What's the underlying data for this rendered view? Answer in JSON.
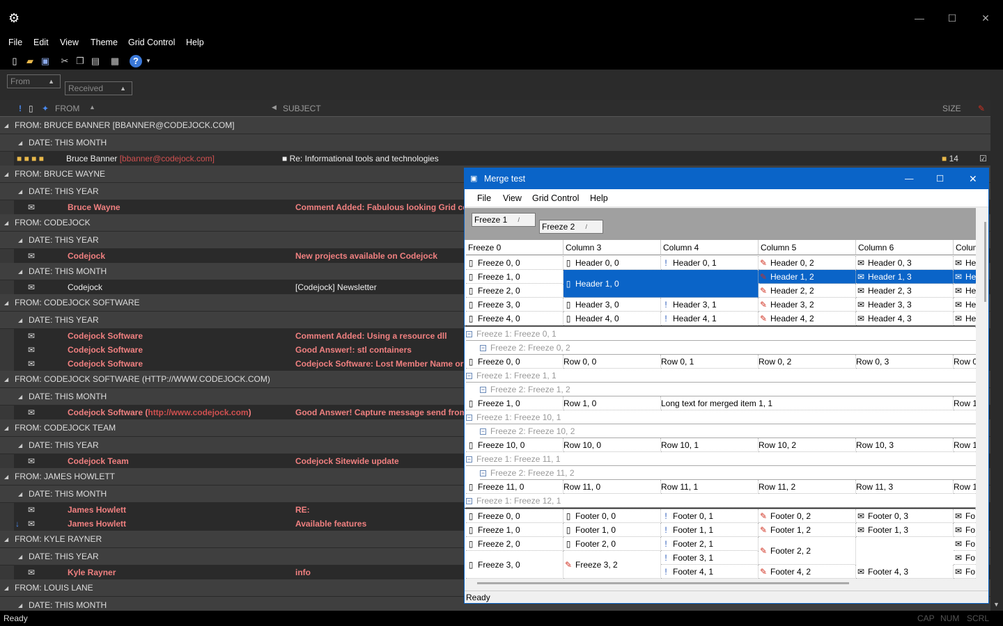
{
  "window": {
    "minimize": "—",
    "maximize": "☐",
    "close": "✕",
    "app_icon": "⚙"
  },
  "menu": [
    "File",
    "Edit",
    "View",
    "Theme",
    "Grid Control",
    "Help"
  ],
  "group_chips": [
    "From",
    "Received"
  ],
  "columns": {
    "from": "FROM",
    "subject": "SUBJECT",
    "size": "SIZE"
  },
  "rows": [
    {
      "kind": "grp",
      "level": 0,
      "label": "FROM: BRUCE BANNER [BBANNER@CODEJOCK.COM]"
    },
    {
      "kind": "grp",
      "level": 1,
      "label": "DATE: THIS MONTH"
    },
    {
      "kind": "msg",
      "icon": "lock",
      "from": "Bruce Banner",
      "email": "[bbanner@codejock.com]",
      "subject": "Re: Informational tools and technologies",
      "size": "14",
      "unread": false
    },
    {
      "kind": "grp",
      "level": 0,
      "label": "FROM: BRUCE WAYNE"
    },
    {
      "kind": "grp",
      "level": 1,
      "label": "DATE: THIS YEAR"
    },
    {
      "kind": "msg",
      "icon": "env",
      "from": "Bruce Wayne",
      "subject": "Comment Added: Fabulous looking Grid control",
      "unread": true
    },
    {
      "kind": "grp",
      "level": 0,
      "label": "FROM: CODEJOCK"
    },
    {
      "kind": "grp",
      "level": 1,
      "label": "DATE: THIS YEAR"
    },
    {
      "kind": "msg",
      "icon": "env",
      "from": "Codejock",
      "subject": "New projects available on Codejock",
      "unread": true
    },
    {
      "kind": "grp",
      "level": 1,
      "label": "DATE: THIS MONTH"
    },
    {
      "kind": "msg",
      "icon": "open",
      "from": "Codejock",
      "subject": "[Codejock] Newsletter",
      "unread": false
    },
    {
      "kind": "grp",
      "level": 0,
      "label": "FROM: CODEJOCK SOFTWARE"
    },
    {
      "kind": "grp",
      "level": 1,
      "label": "DATE: THIS YEAR"
    },
    {
      "kind": "msg",
      "icon": "env",
      "from": "Codejock Software",
      "subject": "Comment Added: Using a resource dll",
      "unread": true
    },
    {
      "kind": "msg",
      "icon": "env",
      "from": "Codejock Software",
      "subject": "Good Answer!: stl containers",
      "unread": true
    },
    {
      "kind": "msg",
      "icon": "env",
      "from": "Codejock Software",
      "subject": "Codejock Software:  Lost Member Name or Password",
      "unread": true
    },
    {
      "kind": "grp",
      "level": 0,
      "label": "FROM: CODEJOCK SOFTWARE (HTTP://WWW.CODEJOCK.COM)"
    },
    {
      "kind": "grp",
      "level": 1,
      "label": "DATE: THIS MONTH"
    },
    {
      "kind": "msg",
      "icon": "env",
      "from": "Codejock Software (",
      "url": "http://www.codejock.com",
      "from_tail": ")",
      "subject": "Good Answer! Capture message send from Net",
      "unread": true
    },
    {
      "kind": "grp",
      "level": 0,
      "label": "FROM: CODEJOCK TEAM"
    },
    {
      "kind": "grp",
      "level": 1,
      "label": "DATE: THIS YEAR"
    },
    {
      "kind": "msg",
      "icon": "env",
      "from": "Codejock Team",
      "subject": "Codejock Sitewide update",
      "unread": true
    },
    {
      "kind": "grp",
      "level": 0,
      "label": "FROM: JAMES HOWLETT"
    },
    {
      "kind": "grp",
      "level": 1,
      "label": "DATE: THIS MONTH"
    },
    {
      "kind": "msg",
      "icon": "env",
      "from": "James Howlett",
      "subject": "RE:",
      "unread": true
    },
    {
      "kind": "msg",
      "icon": "env",
      "down": true,
      "from": "James Howlett",
      "subject": "Available features",
      "unread": true
    },
    {
      "kind": "grp",
      "level": 0,
      "label": "FROM: KYLE RAYNER"
    },
    {
      "kind": "grp",
      "level": 1,
      "label": "DATE: THIS YEAR"
    },
    {
      "kind": "msg",
      "icon": "env",
      "from": "Kyle Rayner",
      "subject": "info",
      "unread": true
    },
    {
      "kind": "grp",
      "level": 0,
      "label": "FROM: LOUIS LANE"
    },
    {
      "kind": "grp",
      "level": 1,
      "label": "DATE: THIS MONTH"
    }
  ],
  "status": {
    "text": "Ready",
    "cap": "CAP",
    "num": "NUM",
    "scrl": "SCRL"
  },
  "dialog": {
    "title": "Merge test",
    "menu": [
      "File",
      "View",
      "Grid Control",
      "Help"
    ],
    "chips": [
      "Freeze 1",
      "Freeze 2"
    ],
    "headers": [
      "Freeze 0",
      "Column 3",
      "Column 4",
      "Column 5",
      "Column 6",
      "Colum"
    ],
    "status": "Ready"
  }
}
